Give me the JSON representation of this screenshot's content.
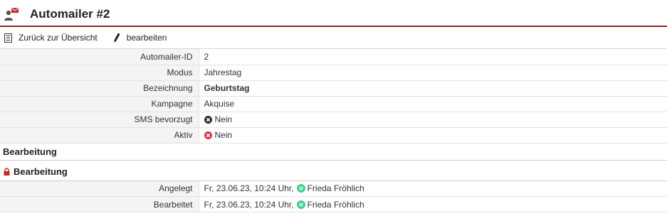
{
  "header": {
    "title": "Automailer #2",
    "icon": "automailer-icon"
  },
  "toolbar": {
    "back_label": "Zurück zur Übersicht",
    "edit_label": "bearbeiten"
  },
  "details": {
    "id_label": "Automailer-ID",
    "id_value": "2",
    "mode_label": "Modus",
    "mode_value": "Jahrestag",
    "name_label": "Bezeichnung",
    "name_value": "Geburtstag",
    "campaign_label": "Kampagne",
    "campaign_value": "Akquise",
    "sms_label": "SMS bevorzugt",
    "sms_value": "Nein",
    "active_label": "Aktiv",
    "active_value": "Nein"
  },
  "editing": {
    "section_title": "Bearbeitung",
    "subsection_title": "Bearbeitung",
    "created_label": "Angelegt",
    "created_value": "Fr, 23.06.23, 10:24 Uhr,",
    "created_user": "Frieda Fröhlich",
    "modified_label": "Bearbeitet",
    "modified_value": "Fr, 23.06.23, 10:24 Uhr,",
    "modified_user": "Frieda Fröhlich"
  },
  "colors": {
    "accent": "#8b2a2a",
    "inactive": "#d9333f",
    "user": "#3fcf8e"
  }
}
